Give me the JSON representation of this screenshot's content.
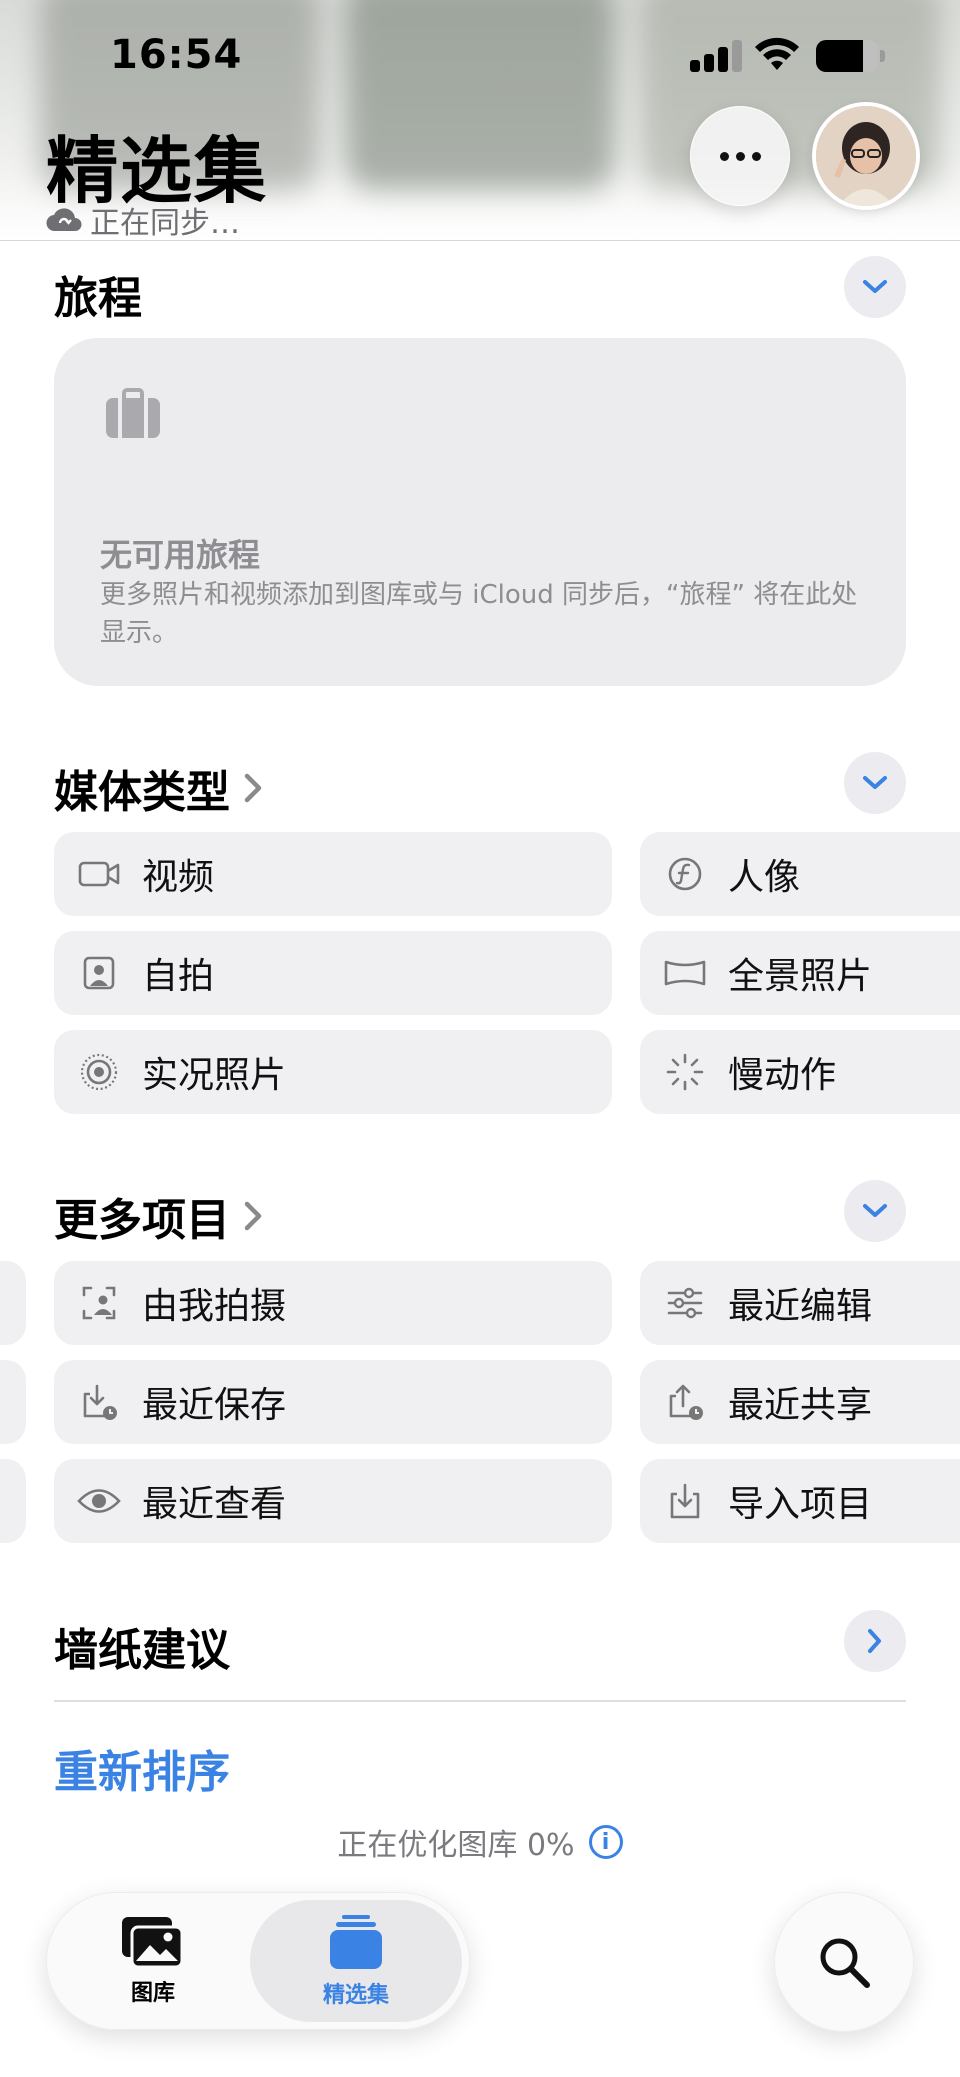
{
  "status": {
    "time": "16:54",
    "battery_level": 0.75
  },
  "header": {
    "title": "精选集",
    "sync_status": "正在同步…"
  },
  "trips": {
    "title": "旅程",
    "empty_title": "无可用旅程",
    "empty_desc": "更多照片和视频添加到图库或与 iCloud 同步后，“旅程” 将在此处显示。"
  },
  "media_types": {
    "title": "媒体类型",
    "items": [
      {
        "label": "视频",
        "icon": "video-icon"
      },
      {
        "label": "人像",
        "icon": "portrait-f-icon"
      },
      {
        "label": "自拍",
        "icon": "selfie-icon"
      },
      {
        "label": "全景照片",
        "icon": "panorama-icon"
      },
      {
        "label": "实况照片",
        "icon": "live-photo-icon"
      },
      {
        "label": "慢动作",
        "icon": "slo-mo-icon"
      }
    ]
  },
  "more_items": {
    "title": "更多项目",
    "items": [
      {
        "label": "由我拍摄",
        "icon": "taken-by-me-icon"
      },
      {
        "label": "最近编辑",
        "icon": "sliders-icon"
      },
      {
        "label": "最近保存",
        "icon": "recently-saved-icon"
      },
      {
        "label": "最近共享",
        "icon": "recently-shared-icon"
      },
      {
        "label": "最近查看",
        "icon": "eye-icon"
      },
      {
        "label": "导入项目",
        "icon": "import-icon"
      }
    ]
  },
  "wallpaper": {
    "title": "墙纸建议"
  },
  "reorder_label": "重新排序",
  "optimize_status": "正在优化图库 0%",
  "tabbar": {
    "library": "图库",
    "featured": "精选集"
  },
  "colors": {
    "accent": "#3a82e4",
    "tile_bg": "#f0f0f3",
    "secondary_text": "#7a7a7f"
  }
}
